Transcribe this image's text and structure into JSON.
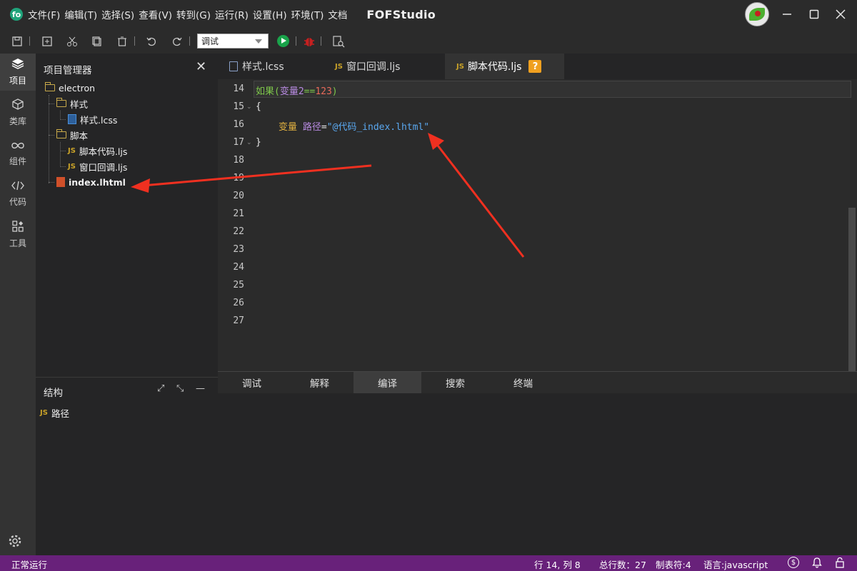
{
  "titlebar": {
    "menu": [
      "文件(F)",
      "编辑(T)",
      "选择(S)",
      "查看(V)",
      "转到(G)",
      "运行(R)",
      "设置(H)",
      "环境(T)",
      "文档"
    ],
    "app_title": "FOFStudio",
    "window_controls": [
      "minimize-icon",
      "maximize-icon",
      "close-icon"
    ]
  },
  "toolbar": {
    "icons": [
      "save-icon",
      "new-file-icon",
      "cut-icon",
      "copy-icon",
      "delete-icon",
      "undo-icon",
      "redo-icon"
    ],
    "run_mode": "调试",
    "run_icon_color": "#19a34a",
    "debug_icon_color": "#c62020"
  },
  "activity": {
    "items": [
      {
        "label": "项目",
        "icon": "layers-icon"
      },
      {
        "label": "类库",
        "icon": "cube-icon"
      },
      {
        "label": "组件",
        "icon": "infinity-icon"
      },
      {
        "label": "代码",
        "icon": "code-icon"
      },
      {
        "label": "工具",
        "icon": "tools-icon"
      }
    ]
  },
  "explorer": {
    "title": "项目管理器",
    "tree": {
      "root": "electron",
      "folder_style": "样式",
      "file_lcss": "样式.lcss",
      "folder_script": "脚本",
      "file_script": "脚本代码.ljs",
      "file_window": "窗口回调.ljs",
      "file_index": "index.lhtml"
    }
  },
  "structure": {
    "title": "结构",
    "items": [
      "路径"
    ]
  },
  "tabs": [
    {
      "label": "样式.lcss",
      "type": "lcss"
    },
    {
      "label": "窗口回调.ljs",
      "type": "js"
    },
    {
      "label": "脚本代码.ljs",
      "type": "js",
      "active": true,
      "badge": "?"
    }
  ],
  "editor": {
    "line_numbers": [
      "14",
      "15",
      "16",
      "17",
      "18",
      "19",
      "20",
      "21",
      "22",
      "23",
      "24",
      "25",
      "26",
      "27"
    ],
    "code": {
      "l14_kw": "如果(",
      "l14_var": "变量2",
      "l14_op": "==",
      "l14_num": "123",
      "l14_close": ")",
      "l15": "{",
      "l16_decl": "变量",
      "l16_var": "路径",
      "l16_eq": "=",
      "l16_str": "\"@代码_index.lhtml\"",
      "l17": "}"
    }
  },
  "bottom_panel": {
    "tabs": [
      "调试",
      "解释",
      "编译",
      "搜索",
      "终端"
    ],
    "active": "编译"
  },
  "statusbar": {
    "left": "正常运行",
    "position": "行 14, 列 8",
    "total_lines": "总行数：27",
    "tab_size": "制表符:4",
    "language": "语言:javascript",
    "color": "#68217a"
  }
}
